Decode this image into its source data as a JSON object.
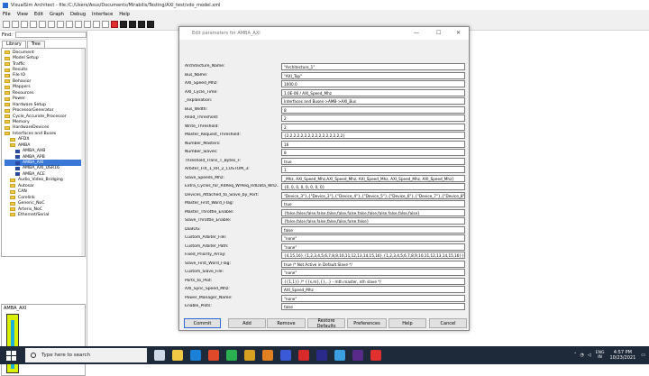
{
  "app": {
    "title": "VisualSim Architect - file:/C:/Users/Asus/Documents/Mirabilis/Testing/AXI_test/vdo_model.xml",
    "menu": [
      "File",
      "View",
      "Edit",
      "Graph",
      "Debug",
      "Interface",
      "Help"
    ]
  },
  "left": {
    "find_label": "Find:",
    "find_value": "",
    "tabs": [
      "Library",
      "Tree"
    ],
    "tree": [
      {
        "label": "Document",
        "kind": "folder",
        "indent": 0
      },
      {
        "label": "Model Setup",
        "kind": "folder",
        "indent": 0
      },
      {
        "label": "Traffic",
        "kind": "folder",
        "indent": 0
      },
      {
        "label": "Results",
        "kind": "folder",
        "indent": 0
      },
      {
        "label": "File IO",
        "kind": "folder",
        "indent": 0
      },
      {
        "label": "Behavior",
        "kind": "folder",
        "indent": 0
      },
      {
        "label": "Mappers",
        "kind": "folder",
        "indent": 0
      },
      {
        "label": "Resources",
        "kind": "folder",
        "indent": 0
      },
      {
        "label": "Power",
        "kind": "folder",
        "indent": 0
      },
      {
        "label": "Hardware Setup",
        "kind": "folder",
        "indent": 0
      },
      {
        "label": "ProcessorGenerator",
        "kind": "folder",
        "indent": 0
      },
      {
        "label": "Cycle_Accurate_Processor",
        "kind": "folder",
        "indent": 0
      },
      {
        "label": "Memory",
        "kind": "folder",
        "indent": 0
      },
      {
        "label": "HardwareDevices",
        "kind": "folder",
        "indent": 0
      },
      {
        "label": "Interfaces and Buses",
        "kind": "folder",
        "indent": 0
      },
      {
        "label": "AFDX",
        "kind": "folder",
        "indent": 1
      },
      {
        "label": "AMBA",
        "kind": "folder",
        "indent": 1
      },
      {
        "label": "AMBA_AHB",
        "kind": "comp",
        "indent": 2
      },
      {
        "label": "AMBA_APB",
        "kind": "comp",
        "indent": 2
      },
      {
        "label": "AMBA_AXI",
        "kind": "comp",
        "indent": 2,
        "selected": true
      },
      {
        "label": "AMBA_AXI_USR16",
        "kind": "comp",
        "indent": 2
      },
      {
        "label": "AMBA_ACE",
        "kind": "comp",
        "indent": 2
      },
      {
        "label": "Audio_Video_Bridging",
        "kind": "folder",
        "indent": 1
      },
      {
        "label": "Autosar",
        "kind": "folder",
        "indent": 1
      },
      {
        "label": "CAN",
        "kind": "folder",
        "indent": 1
      },
      {
        "label": "Corelink",
        "kind": "folder",
        "indent": 1
      },
      {
        "label": "Generic_NoC",
        "kind": "folder",
        "indent": 1
      },
      {
        "label": "Arteris_NoC",
        "kind": "folder",
        "indent": 1
      },
      {
        "label": "Ethernet/Serial",
        "kind": "folder",
        "indent": 1
      }
    ],
    "preview_title": "AMBA_AXI"
  },
  "dialog": {
    "title": "Edit parameters for AMBA_AXI",
    "controls": [
      "—",
      "☐",
      "✕"
    ],
    "params": [
      {
        "label": "Architecture_Name:",
        "value": "\"Architecture_1\""
      },
      {
        "label": "Bus_Name:",
        "value": "\"AXI_Top\""
      },
      {
        "label": "AXI_Speed_Mhz:",
        "value": "1000.0"
      },
      {
        "label": "AXI_Cycle_Time:",
        "value": "1.0E-06 / AXI_Speed_Mhz"
      },
      {
        "label": "_explanation:",
        "value": "Interfaces and Buses->AMB->AXI_Bus"
      },
      {
        "label": "Bus_Width:",
        "value": "8"
      },
      {
        "label": "Read_Threshold:",
        "value": "2"
      },
      {
        "label": "Write_Threshold:",
        "value": "2"
      },
      {
        "label": "Master_Request_Threshold:",
        "value": "{2,2,2,2,2,2,2,2,2,2,2,2,2,2,2,2}"
      },
      {
        "label": "Number_Masters:",
        "value": "16"
      },
      {
        "label": "Number_Slaves:",
        "value": "8"
      },
      {
        "label": "Threshold_Trans_T_Bytes_F:",
        "value": "true"
      },
      {
        "label": "Arbiter_FIX_1_RR_2_CUSTOM_3:",
        "value": "1"
      },
      {
        "label": "Slave_Speeds_Mhz:",
        "value": "_Mhz, AXI_Speed_Mhz,AXI_Speed_Mhz, AXI_Speed_Mhz, AXI_Speed_Mhz, AXI_Speed_Mhz}"
      },
      {
        "label": "Extra_Cycles_for_RdReq_WrReq_RdData_WrD...",
        "value": "{0, 0, 0, 0, 0, 0, 0, 0}"
      },
      {
        "label": "Devices_Attached_to_Slave_by_Port:",
        "value": "\"Device_3\"},{\"Device_3\"},{\"Device_4\"},{\"Device_5\"},{\"Device_6\"},{\"Device_7\"},{\"Device_8\"}}"
      },
      {
        "label": "Master_First_Word_Flag:",
        "value": "true"
      },
      {
        "label": "Master_Throttle_Enable:",
        "value": "{false,false,false,false,false,false,false,false,false,false,false,false,false}"
      },
      {
        "label": "Slave_Throttle_Enable:",
        "value": "{false,false,false,false,false,false,false,false}"
      },
      {
        "label": "DEBUG:",
        "value": "false"
      },
      {
        "label": "Custom_Arbiter_File:",
        "value": "\"none\""
      },
      {
        "label": "Custom_Arbiter_Path:",
        "value": "\"none\""
      },
      {
        "label": "Fixed_Priority_Array:",
        "value": "{4,15,16},{1,2,3,4,5,6,7,8,9,10,11,12,13,14,15,16},{1,2,3,4,5,6,7,8,9,10,11,12,13,14,15,16}}"
      },
      {
        "label": "Slave_First_Word_Flag:",
        "value": "true  /* Not Active in Default Slave */"
      },
      {
        "label": "Custom_Slave_File:",
        "value": "\"none\""
      },
      {
        "label": "Ports_to_Plot:",
        "value": "{{1,1}} /* {{s,m},{},..} - mth master, nth slave */"
      },
      {
        "label": "AXI_Sync_Speed_Mhz:",
        "value": "AXI_Speed_Mhz"
      },
      {
        "label": "Power_Manager_Name:",
        "value": "\"none\""
      },
      {
        "label": "Enable_Plots:",
        "value": "false"
      }
    ],
    "buttons": [
      "Commit",
      "Add",
      "Remove",
      "Restore Defaults",
      "Preferences",
      "Help",
      "Cancel"
    ]
  },
  "taskbar": {
    "search_placeholder": "Type here to search",
    "lang_top": "ENG",
    "lang_bottom": "IN",
    "time": "4:57 PM",
    "date": "10/23/2021"
  },
  "colors": {
    "taskbar": "#1e2a3a",
    "selection": "#3a78d8",
    "folder": "#f2c744",
    "preview_block": "#d8f000"
  }
}
